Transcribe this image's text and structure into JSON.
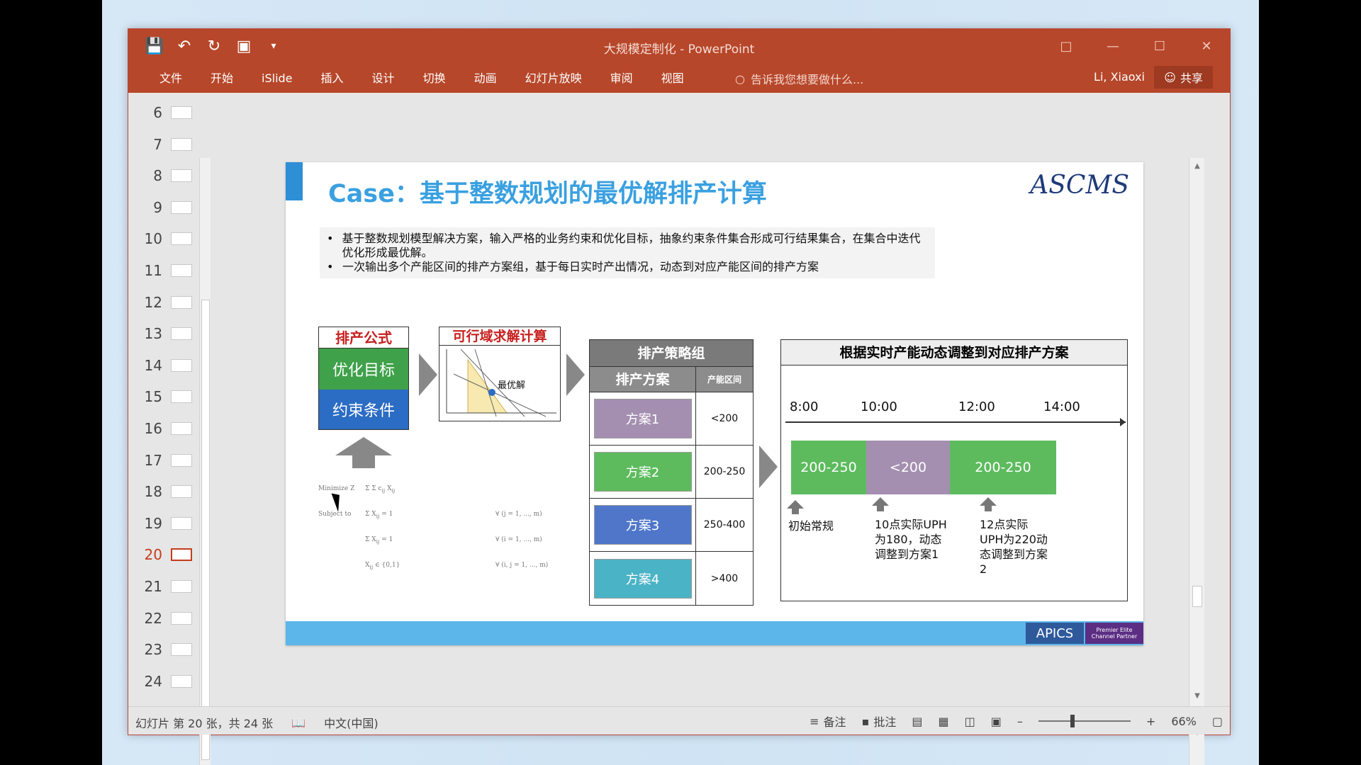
{
  "window": {
    "title": "大规模定制化 - PowerPoint",
    "qat_icons": [
      "save-icon",
      "undo-icon",
      "redo-icon",
      "present-icon",
      "customize-icon"
    ]
  },
  "ribbon": {
    "tabs": [
      "文件",
      "开始",
      "iSlide",
      "插入",
      "设计",
      "切换",
      "动画",
      "幻灯片放映",
      "审阅",
      "视图"
    ],
    "tellme": "告诉我您想要做什么...",
    "user": "Li, Xiaoxi",
    "share": "共享"
  },
  "thumbnails": {
    "items": [
      "6",
      "7",
      "8",
      "9",
      "10",
      "11",
      "12",
      "13",
      "14",
      "15",
      "16",
      "17",
      "18",
      "19",
      "20",
      "21",
      "22",
      "23",
      "24"
    ],
    "active": "20"
  },
  "slide": {
    "title": "Case：基于整数规划的最优解排产计算",
    "logo": "ASCMS",
    "bullets": [
      "基于整数规划模型解决方案，输入严格的业务约束和优化目标，抽象约束条件集合形成可行结果集合，在集合中迭代优化形成最优解。",
      "一次输出多个产能区间的排产方案组，基于每日实时产出情况，动态到对应产能区间的排产方案"
    ],
    "formula": {
      "head": "排产公式",
      "objective": "优化目标",
      "constraint": "约束条件"
    },
    "feasible": {
      "head": "可行域求解计算",
      "optimum": "最优解"
    },
    "math": {
      "minimize": "Minimize Z",
      "subject": "Subject to"
    },
    "strategy": {
      "head": "排产策略组",
      "col_plan": "排产方案",
      "col_range": "产能区间",
      "rows": [
        {
          "plan": "方案1",
          "range": "<200",
          "color": "#a48fb1"
        },
        {
          "plan": "方案2",
          "range": "200-250",
          "color": "#5dbb5e"
        },
        {
          "plan": "方案3",
          "range": "250-400",
          "color": "#4f76c9"
        },
        {
          "plan": "方案4",
          "range": ">400",
          "color": "#4bb3c6"
        }
      ]
    },
    "dynamic": {
      "head": "根据实时产能动态调整到对应排产方案",
      "times": [
        "8:00",
        "10:00",
        "12:00",
        "14:00"
      ],
      "segments": [
        {
          "label": "200-250",
          "color": "#5dbb5e"
        },
        {
          "label": "<200",
          "color": "#a48fb1"
        },
        {
          "label": "200-250",
          "color": "#5dbb5e"
        }
      ],
      "notes": [
        "初始常规",
        "10点实际UPH为180，动态调整到方案1",
        "12点实际UPH为220动态调整到方案2"
      ]
    },
    "footer": {
      "apics": "APICS",
      "partner": "Premier Elite Channel Partner"
    }
  },
  "statusbar": {
    "slide_info": "幻灯片 第 20 张，共 24 张",
    "language": "中文(中国)",
    "notes": "备注",
    "comments": "批注",
    "zoom": "66%"
  }
}
